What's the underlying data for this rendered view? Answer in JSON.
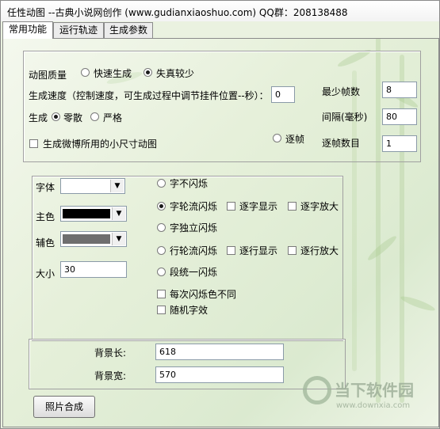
{
  "window": {
    "title": "任性动图 --古典小说网创作 (www.gudianxiaoshuo.com)  QQ群：208138488"
  },
  "tabs": [
    "常用功能",
    "运行轨迹",
    "生成参数"
  ],
  "quality": {
    "label": "动图质量",
    "options": [
      "快速生成",
      "失真较少"
    ],
    "selected": "失真较少"
  },
  "speed": {
    "label": "生成速度（控制速度，可生成过程中调节挂件位置--秒）：",
    "value": "0"
  },
  "mode": {
    "label": "生成",
    "options": [
      "零散",
      "严格"
    ],
    "selected": "零散"
  },
  "weibo_checkbox": {
    "label": "生成微博所用的小尺寸动图",
    "checked": false
  },
  "frame_radio": {
    "label": "逐帧",
    "selected": false
  },
  "min_frames": {
    "label": "最少帧数",
    "value": "8"
  },
  "interval": {
    "label": "间隔(毫秒)",
    "value": "80"
  },
  "frame_count": {
    "label": "逐帧数目",
    "value": "1"
  },
  "text_style": {
    "font_label": "字体",
    "font_value": "",
    "main_color_label": "主色",
    "main_color": "#000000",
    "aux_color_label": "辅色",
    "aux_color": "#6e6e6e",
    "size_label": "大小",
    "size_value": "30"
  },
  "effects": {
    "options": [
      "字不闪烁",
      "字轮流闪烁",
      "字独立闪烁",
      "行轮流闪烁",
      "段统一闪烁"
    ],
    "selected": "字轮流闪烁",
    "char_show": "逐字显示",
    "char_zoom": "逐字放大",
    "line_show": "逐行显示",
    "line_zoom": "逐行放大",
    "diff_color": "每次闪烁色不同",
    "random_font": "随机字效"
  },
  "background": {
    "length_label": "背景长:",
    "length_value": "618",
    "width_label": "背景宽:",
    "width_value": "570"
  },
  "compose_button": "照片合成",
  "watermark": {
    "brand": "当下软件园",
    "url": "www.downxia.com"
  }
}
